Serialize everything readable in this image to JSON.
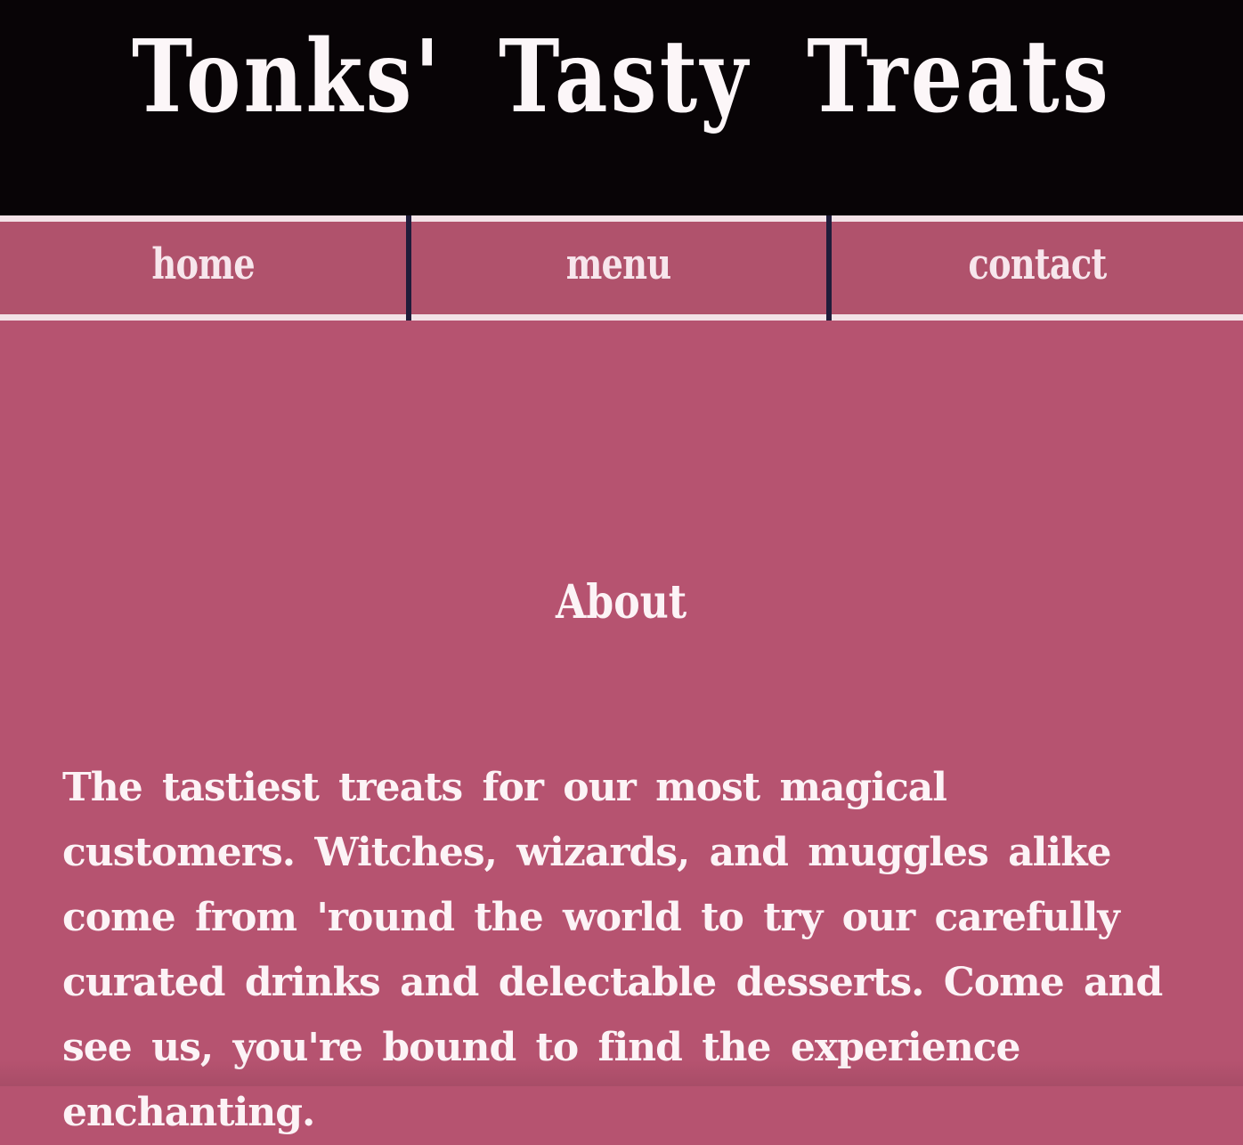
{
  "header": {
    "title": "Tonks' Tasty Treats"
  },
  "nav": {
    "items": [
      {
        "label": "home"
      },
      {
        "label": "menu"
      },
      {
        "label": "contact"
      }
    ]
  },
  "about": {
    "heading": "About",
    "text": "The tastiest treats for our most magical customers. Witches, wizards, and muggles alike come from 'round the world to try our carefully curated drinks and delectable desserts. Come and see us, you're bound to find the experience enchanting."
  },
  "colors": {
    "header_bg": "#080406",
    "nav_bg": "#b0526c",
    "nav_border": "#f3e2e7",
    "nav_divider": "#201c3a",
    "main_bg": "#b65370",
    "text": "#fcf3f6"
  }
}
